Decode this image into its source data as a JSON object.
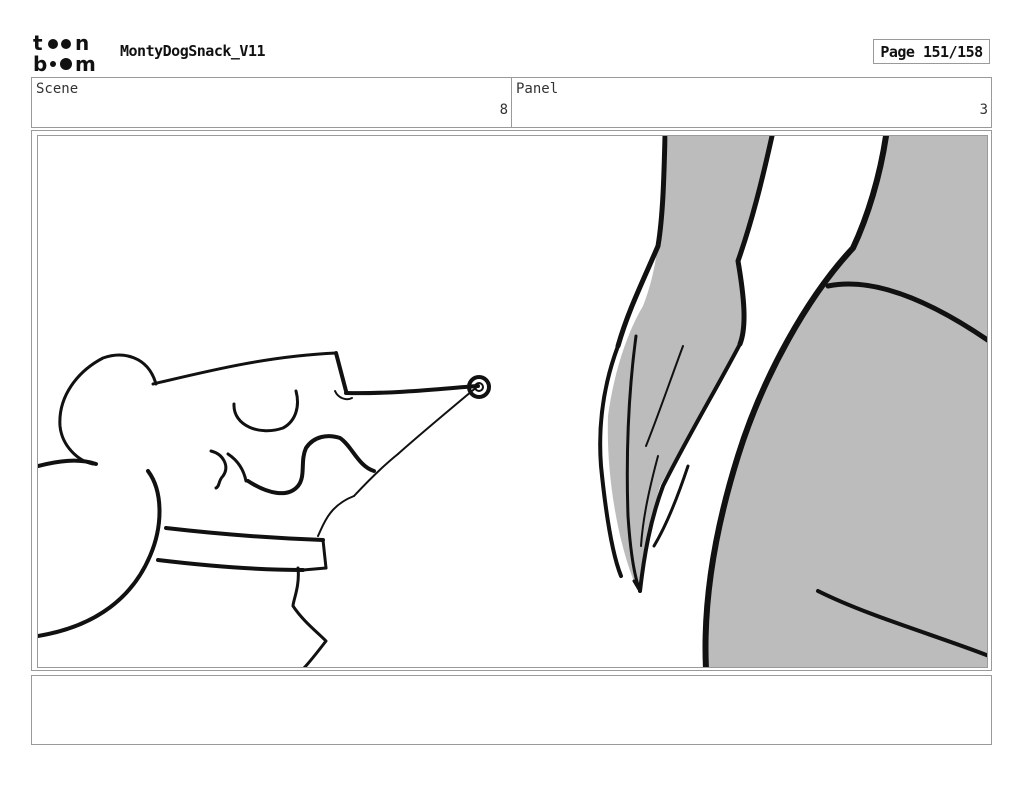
{
  "header": {
    "logo_text": "toonboom",
    "project_title": "MontyDogSnack_V11",
    "page_label": "Page 151/158"
  },
  "scene": {
    "label": "Scene",
    "value": "8"
  },
  "panel": {
    "label": "Panel",
    "value": "3"
  },
  "notes": {
    "text": ""
  }
}
